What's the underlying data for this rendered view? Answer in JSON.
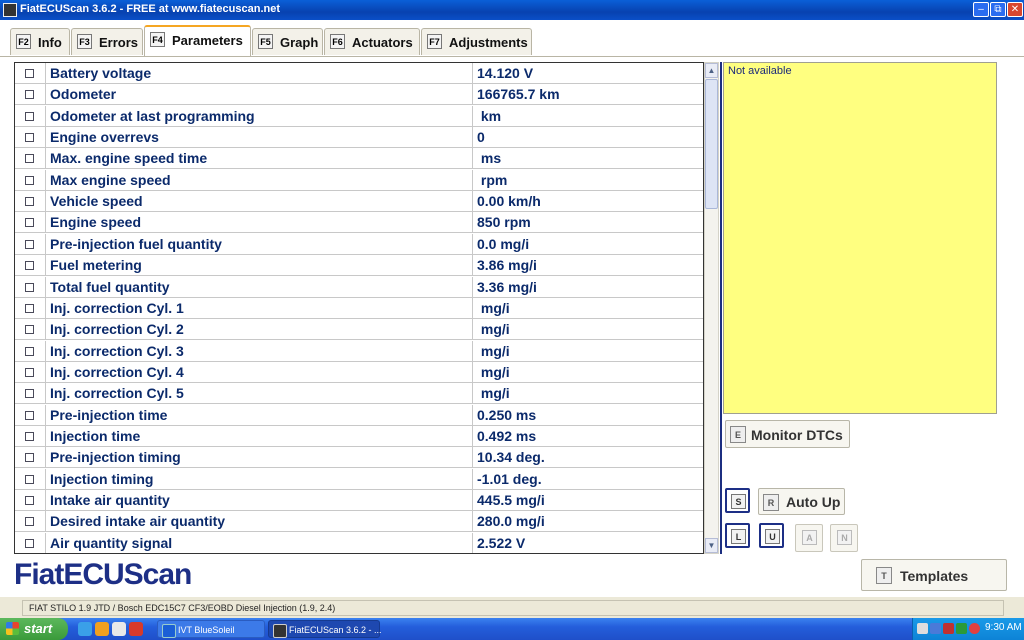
{
  "window": {
    "title": "FiatECUScan 3.6.2 - FREE at www.fiatecuscan.net"
  },
  "tabs": [
    {
      "key": "F2",
      "label": "Info"
    },
    {
      "key": "F3",
      "label": "Errors"
    },
    {
      "key": "F4",
      "label": "Parameters"
    },
    {
      "key": "F5",
      "label": "Graph"
    },
    {
      "key": "F6",
      "label": "Actuators"
    },
    {
      "key": "F7",
      "label": "Adjustments"
    }
  ],
  "parameters": [
    {
      "name": "Battery voltage",
      "value": "14.120 V"
    },
    {
      "name": "Odometer",
      "value": "166765.7 km"
    },
    {
      "name": "Odometer at last programming",
      "value": " km"
    },
    {
      "name": "Engine overrevs",
      "value": "0"
    },
    {
      "name": "Max. engine speed time",
      "value": " ms"
    },
    {
      "name": "Max engine speed",
      "value": " rpm"
    },
    {
      "name": "Vehicle speed",
      "value": "0.00 km/h"
    },
    {
      "name": "Engine speed",
      "value": "850 rpm"
    },
    {
      "name": "Pre-injection fuel quantity",
      "value": "0.0 mg/i"
    },
    {
      "name": "Fuel metering",
      "value": "3.86 mg/i"
    },
    {
      "name": "Total fuel quantity",
      "value": "3.36 mg/i"
    },
    {
      "name": "Inj. correction Cyl. 1",
      "value": " mg/i"
    },
    {
      "name": "Inj. correction Cyl. 2",
      "value": " mg/i"
    },
    {
      "name": "Inj. correction Cyl. 3",
      "value": " mg/i"
    },
    {
      "name": "Inj. correction Cyl. 4",
      "value": " mg/i"
    },
    {
      "name": "Inj. correction Cyl. 5",
      "value": " mg/i"
    },
    {
      "name": "Pre-injection time",
      "value": "0.250 ms"
    },
    {
      "name": "Injection time",
      "value": "0.492 ms"
    },
    {
      "name": "Pre-injection timing",
      "value": "10.34 deg."
    },
    {
      "name": "Injection timing",
      "value": "-1.01 deg."
    },
    {
      "name": "Intake air quantity",
      "value": "445.5 mg/i"
    },
    {
      "name": "Desired intake air quantity",
      "value": "280.0 mg/i"
    },
    {
      "name": "Air quantity signal",
      "value": "2.522 V"
    }
  ],
  "info_panel": {
    "text": "Not available"
  },
  "buttons": {
    "monitor_dtcs": {
      "key": "E",
      "label": "Monitor DTCs"
    },
    "auto_up": {
      "key": "R",
      "label": "Auto Up"
    },
    "s": "S",
    "l": "L",
    "u": "U",
    "a": "A",
    "n": "N",
    "templates": {
      "key": "T",
      "label": "Templates"
    }
  },
  "logo": "FiatECUScan",
  "status": {
    "text": "FIAT STILO 1.9 JTD / Bosch EDC15C7 CF3/EOBD Diesel Injection (1.9, 2.4)"
  },
  "taskbar": {
    "start": "start",
    "tasks": [
      {
        "label": "IVT BlueSoleil"
      },
      {
        "label": "FiatECUScan 3.6.2 - ..."
      }
    ],
    "clock": "9:30 AM"
  }
}
